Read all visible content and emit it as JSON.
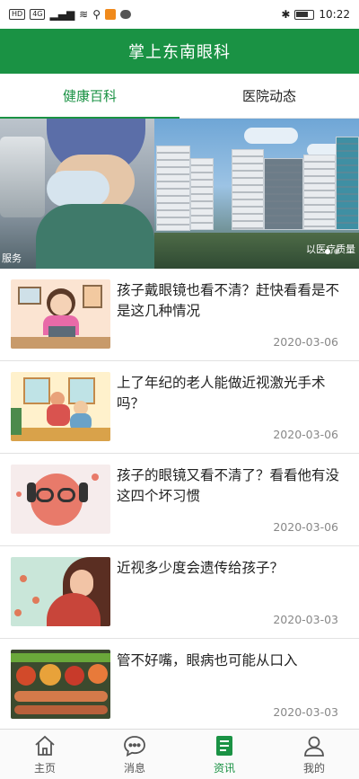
{
  "status_bar": {
    "left_chip_1": "HD",
    "left_chip_2": "4G",
    "time": "10:22"
  },
  "header": {
    "title": "掌上东南眼科"
  },
  "tabs": [
    {
      "label": "健康百科",
      "active": true
    },
    {
      "label": "医院动态",
      "active": false
    }
  ],
  "banner": {
    "caption_left": "服务",
    "caption_right": "以医疗质量"
  },
  "news": [
    {
      "title": "孩子戴眼镜也看不清？赶快看看是不是这几种情况",
      "date": "2020-03-06"
    },
    {
      "title": "上了年纪的老人能做近视激光手术吗？",
      "date": "2020-03-06"
    },
    {
      "title": "孩子的眼镜又看不清了？看看他有没这四个坏习惯",
      "date": "2020-03-06"
    },
    {
      "title": "近视多少度会遗传给孩子？",
      "date": "2020-03-03"
    },
    {
      "title": "管不好嘴，眼病也可能从口入",
      "date": "2020-03-03"
    }
  ],
  "bottom_nav": [
    {
      "label": "主页",
      "icon": "home-icon",
      "active": false
    },
    {
      "label": "消息",
      "icon": "message-icon",
      "active": false
    },
    {
      "label": "资讯",
      "icon": "news-icon",
      "active": true
    },
    {
      "label": "我的",
      "icon": "profile-icon",
      "active": false
    }
  ],
  "colors": {
    "brand_green": "#1a9244",
    "date_gray": "#888888"
  }
}
